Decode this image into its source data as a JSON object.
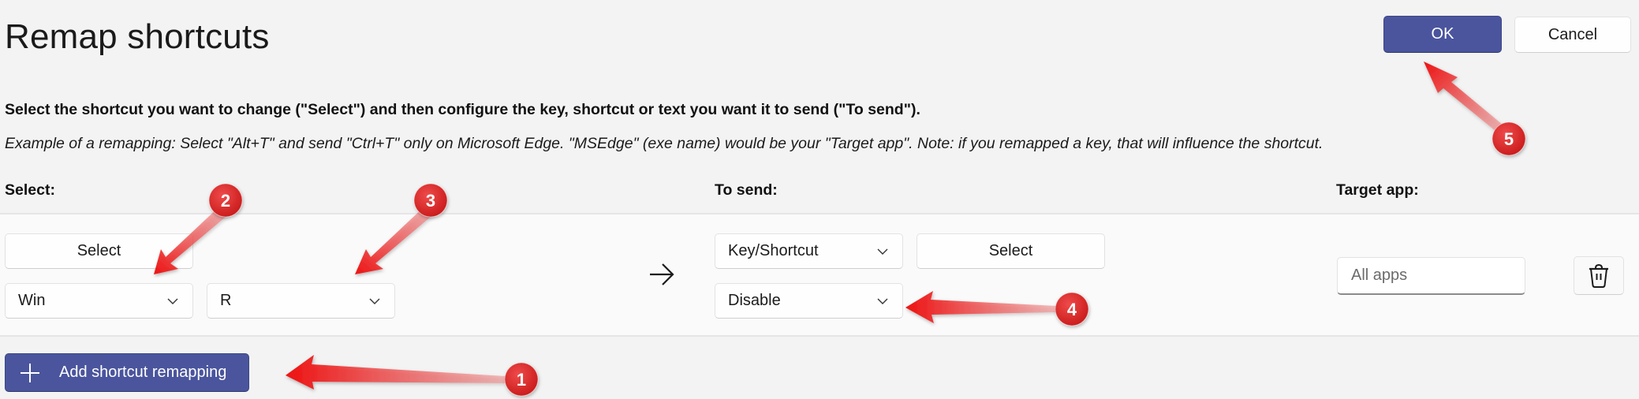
{
  "header": {
    "title": "Remap shortcuts",
    "ok_label": "OK",
    "cancel_label": "Cancel"
  },
  "instructions": {
    "main": "Select the shortcut you want to change (\"Select\") and then configure the key, shortcut or text you want it to send (\"To send\").",
    "example": "Example of a remapping: Select \"Alt+T\" and send \"Ctrl+T\" only on Microsoft Edge. \"MSEdge\" (exe name) would be your \"Target app\". Note: if you remapped a key, that will influence the shortcut."
  },
  "columns": {
    "select": "Select:",
    "to_send": "To send:",
    "target_app": "Target app:"
  },
  "remapping_row": {
    "select_button_label": "Select",
    "modifier_key": "Win",
    "action_key": "R",
    "arrow_icon": "arrow-right-icon",
    "send_type": "Key/Shortcut",
    "send_select_button_label": "Select",
    "send_value": "Disable",
    "target_app_value": "",
    "target_app_placeholder": "All apps",
    "delete_icon": "trash-icon"
  },
  "footer": {
    "add_button_label": "Add shortcut remapping",
    "add_icon": "plus-icon"
  },
  "annotations": {
    "color": "#e31b1b",
    "callouts": [
      {
        "number": "1",
        "points_to": "add-shortcut-remapping-button"
      },
      {
        "number": "2",
        "points_to": "modifier-key-dropdown"
      },
      {
        "number": "3",
        "points_to": "action-key-dropdown"
      },
      {
        "number": "4",
        "points_to": "send-value-dropdown"
      },
      {
        "number": "5",
        "points_to": "ok-button"
      }
    ]
  },
  "colors": {
    "accent": "#4a559d",
    "background": "#f3f3f3",
    "row_background": "#fafafa"
  }
}
